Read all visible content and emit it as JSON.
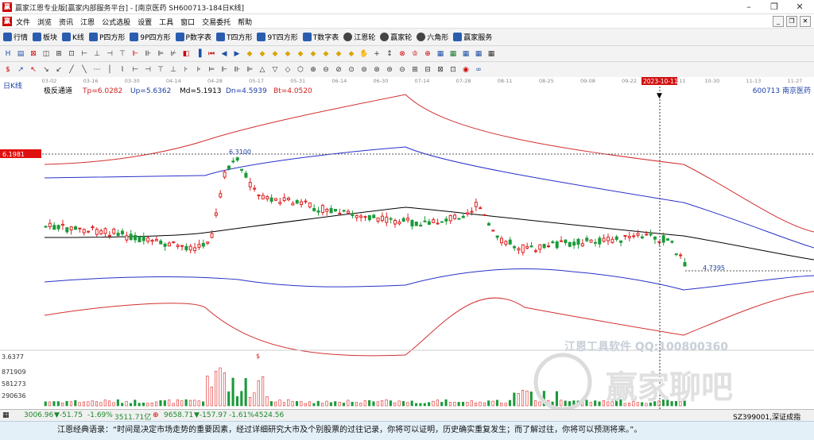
{
  "window": {
    "title": "赢家江恩专业版[赢家内部服务平台] - [南京医药  SH600713-184日K线]",
    "logo": "赢"
  },
  "menu": [
    "文件",
    "浏览",
    "资讯",
    "江恩",
    "公式选股",
    "设置",
    "工具",
    "窗口",
    "交易委托",
    "帮助"
  ],
  "toolbar": [
    {
      "label": "行情",
      "icon": "grid-icon"
    },
    {
      "label": "板块",
      "icon": "block-icon"
    },
    {
      "label": "K线",
      "icon": "kline-icon"
    },
    {
      "label": "P四方形",
      "icon": "square-icon"
    },
    {
      "label": "9P四方形",
      "icon": "square-icon"
    },
    {
      "label": "P数字表",
      "icon": "table-icon"
    },
    {
      "label": "T四方形",
      "icon": "square-icon"
    },
    {
      "label": "9T四方形",
      "icon": "square-icon"
    },
    {
      "label": "T数字表",
      "icon": "table-icon"
    },
    {
      "label": "江恩轮",
      "icon": "wheel-icon"
    },
    {
      "label": "赢家轮",
      "icon": "wheel-icon"
    },
    {
      "label": "六角形",
      "icon": "hexagon-icon"
    },
    {
      "label": "赢家服务",
      "icon": "service-icon"
    }
  ],
  "chart_header": {
    "period": "日K线",
    "indicator": "极反通道",
    "tp": "Tp=6.0282",
    "up": "Up=5.6362",
    "md": "Md=5.1913",
    "dn": "Dn=4.5939",
    "bt": "Bt=4.0520",
    "stock": "600713  南京医药"
  },
  "chart_data": {
    "type": "candlestick",
    "x_ticks": [
      "03-02",
      "03-16",
      "03-30",
      "04-14",
      "04-28",
      "05-17",
      "05-31",
      "06-14",
      "06-30",
      "07-14",
      "07-28",
      "08-11",
      "08-25",
      "09-08",
      "09-22",
      "2023-10-11",
      "10-30",
      "11-13",
      "11-27"
    ],
    "cursor_date": "2023-10-11",
    "cursor_price": "6.1981",
    "annotations": {
      "high": "6.3100",
      "low": "4.7395",
      "marker": "$"
    },
    "volume_ticks": [
      "3.6377",
      "871909",
      "581273",
      "290636"
    ],
    "y_range": [
      3.6,
      7.3
    ]
  },
  "watermark": {
    "line1": "江恩工具软件  QQ:100800360",
    "line2": "赢家聊吧"
  },
  "status": {
    "sh_index": "3006.96",
    "sh_change": "▼-51.75",
    "sh_pct": "-1.69%",
    "sh_amount": "3511.71亿",
    "sz_index": "9658.71",
    "sz_change": "▼-157.97",
    "sz_pct": "-1.61%",
    "sz_amount": "4524.56",
    "right": "SZ399001,深证成指"
  },
  "quote": "江恩经典语录：“时间是决定市场走势的重要因素，经过详细研究大市及个别股票的过往记录，你将可以证明，历史确实重复发生；而了解过往，你将可以预测将来。”。",
  "colors": {
    "red_band": "#d23030",
    "blue_band": "#2830c8",
    "mid": "#000000",
    "up_candle": "#e02020",
    "down_candle": "#1a9a3a",
    "volume": "#1a9a3a",
    "cursor_label_bg": "#e01010"
  }
}
